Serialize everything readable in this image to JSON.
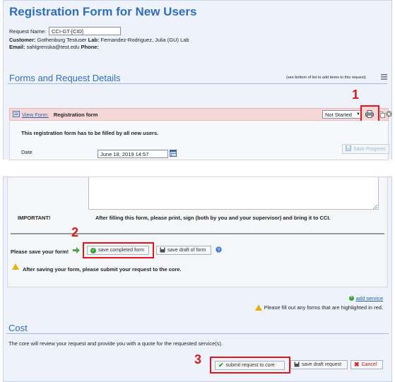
{
  "page": {
    "title": "Registration Form for New Users"
  },
  "request": {
    "name_label": "Request Name:",
    "name_value": "CCI-GT-[CID]",
    "customer_label": "Customer:",
    "customer_value": "Gothenburg Testuser",
    "lab_label": "Lab:",
    "lab_value": "Fernandez-Rodriguez, Julia (GU) Lab",
    "email_label": "Email:",
    "email_value": "sahlgrenska@test.edu",
    "phone_label": "Phone:"
  },
  "forms_section": {
    "title": "Forms and Request Details",
    "hint": "(see bottom of list to add items to this request)"
  },
  "form_item": {
    "view_label": "View Form:",
    "name": "Registration form",
    "status": "Not Started",
    "description": "This registration form has to be filled by all new users.",
    "date_label": "Date",
    "date_value": "June 18, 2019 14:57",
    "save_progress": "Save Progress"
  },
  "important": {
    "label": "IMPORTANT!",
    "text": "After filling this form, please print, sign (both by you and your supervisor) and bring it to CCI."
  },
  "save_form": {
    "prompt": "Please save your form!",
    "save_completed": "save completed form",
    "save_draft": "save draft of form",
    "after_note": "After saving your form, please submit your request to the core."
  },
  "add_service": {
    "label": "add service"
  },
  "fill_warning": "Please fill out any forms that are highlighted in red.",
  "cost": {
    "title": "Cost",
    "text": "The core will review your request and provide you with a quote for the requested service(s)."
  },
  "actions": {
    "submit": "submit request to core",
    "save_draft_request": "save draft request",
    "cancel": "Cancel"
  },
  "annotations": {
    "one": "1",
    "two": "2",
    "three": "3"
  },
  "colors": {
    "accent": "#2f6dbd",
    "highlight": "#e3141c",
    "row_error": "#f6d7d7"
  }
}
